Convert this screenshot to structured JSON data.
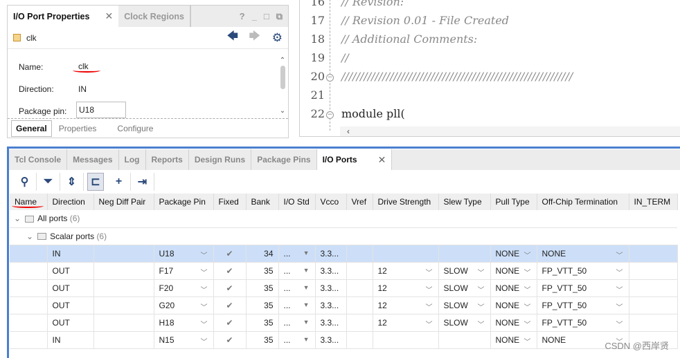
{
  "properties_panel": {
    "tabs": [
      {
        "label": "I/O Port Properties",
        "active": true
      },
      {
        "label": "Clock Regions",
        "active": false
      }
    ],
    "window_controls": [
      "?",
      "_",
      "□",
      "⧉"
    ],
    "object_name": "clk",
    "fields": {
      "name_label": "Name:",
      "name_value": "clk",
      "direction_label": "Direction:",
      "direction_value": "IN",
      "package_pin_label": "Package pin:",
      "package_pin_value": "U18"
    },
    "bottom_tabs": [
      "General",
      "Properties",
      "Configure"
    ]
  },
  "editor": {
    "lines": [
      {
        "num": "16",
        "text": "// Revision:",
        "type": "comment"
      },
      {
        "num": "17",
        "text": "// Revision 0.01 - File Created",
        "type": "comment"
      },
      {
        "num": "18",
        "text": "// Additional Comments:",
        "type": "comment"
      },
      {
        "num": "19",
        "text": "//",
        "type": "comment"
      },
      {
        "num": "20",
        "text": "//////////////////////////////////////////////////////////////",
        "type": "comment"
      },
      {
        "num": "21",
        "text": "",
        "type": "code"
      },
      {
        "num": "22",
        "text": "module pll(",
        "type": "code"
      }
    ]
  },
  "bottom_panel": {
    "tabs": [
      "Tcl Console",
      "Messages",
      "Log",
      "Reports",
      "Design Runs",
      "Package Pins",
      "I/O Ports"
    ],
    "active_tab": "I/O Ports",
    "columns": [
      "Name",
      "Direction",
      "Neg Diff Pair",
      "Package Pin",
      "Fixed",
      "Bank",
      "I/O Std",
      "Vcco",
      "Vref",
      "Drive Strength",
      "Slew Type",
      "Pull Type",
      "Off-Chip Termination",
      "IN_TERM"
    ],
    "groups": [
      {
        "label": "All ports",
        "count": "(6)"
      },
      {
        "label": "Scalar ports",
        "count": "(6)"
      }
    ],
    "rows": [
      {
        "name": "",
        "direction": "IN",
        "pin": "U18",
        "fixed": "✔",
        "bank": "34",
        "iostd": "...",
        "vcco": "3.3...",
        "vref": "",
        "drive": "",
        "slew": "",
        "pull": "NONE",
        "term": "NONE",
        "selected": true
      },
      {
        "name": "",
        "direction": "OUT",
        "pin": "F17",
        "fixed": "✔",
        "bank": "35",
        "iostd": "...",
        "vcco": "3.3...",
        "vref": "",
        "drive": "12",
        "slew": "SLOW",
        "pull": "NONE",
        "term": "FP_VTT_50"
      },
      {
        "name": "",
        "direction": "OUT",
        "pin": "F20",
        "fixed": "✔",
        "bank": "35",
        "iostd": "...",
        "vcco": "3.3...",
        "vref": "",
        "drive": "12",
        "slew": "SLOW",
        "pull": "NONE",
        "term": "FP_VTT_50"
      },
      {
        "name": "",
        "direction": "OUT",
        "pin": "G20",
        "fixed": "✔",
        "bank": "35",
        "iostd": "...",
        "vcco": "3.3...",
        "vref": "",
        "drive": "12",
        "slew": "SLOW",
        "pull": "NONE",
        "term": "FP_VTT_50"
      },
      {
        "name": "",
        "direction": "OUT",
        "pin": "H18",
        "fixed": "✔",
        "bank": "35",
        "iostd": "...",
        "vcco": "3.3...",
        "vref": "",
        "drive": "12",
        "slew": "SLOW",
        "pull": "NONE",
        "term": "FP_VTT_50"
      },
      {
        "name": "",
        "direction": "IN",
        "pin": "N15",
        "fixed": "✔",
        "bank": "35",
        "iostd": "...",
        "vcco": "3.3...",
        "vref": "",
        "drive": "",
        "slew": "",
        "pull": "NONE",
        "term": "NONE"
      }
    ]
  },
  "watermark": "CSDN @西岸贤",
  "colors": {
    "accent": "#4a7fd0",
    "selected_row": "#cddff8",
    "annotation": "#e00000"
  }
}
